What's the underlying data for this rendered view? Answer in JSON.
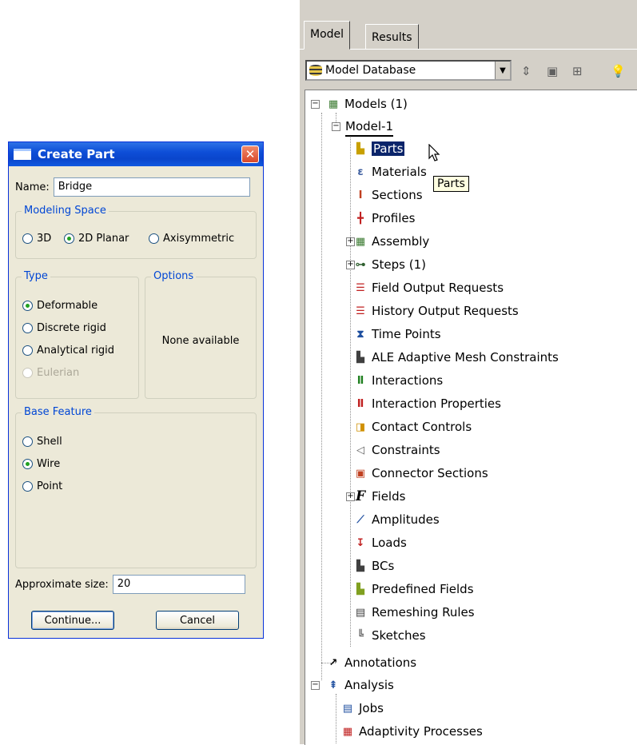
{
  "dialog": {
    "title": "Create Part",
    "name_label": "Name:",
    "name_value": "Bridge",
    "modeling_space": {
      "label": "Modeling Space",
      "options": [
        "3D",
        "2D Planar",
        "Axisymmetric"
      ],
      "selected": "2D Planar"
    },
    "type": {
      "label": "Type",
      "options": [
        "Deformable",
        "Discrete rigid",
        "Analytical rigid",
        "Eulerian"
      ],
      "selected": "Deformable",
      "disabled": [
        "Eulerian"
      ]
    },
    "options": {
      "label": "Options",
      "text": "None available"
    },
    "base_feature": {
      "label": "Base Feature",
      "options": [
        "Shell",
        "Wire",
        "Point"
      ],
      "selected": "Wire"
    },
    "approx_size_label": "Approximate size:",
    "approx_size_value": "20",
    "continue_label": "Continue...",
    "cancel_label": "Cancel"
  },
  "panel": {
    "tabs": [
      "Model",
      "Results"
    ],
    "active_tab": "Model",
    "database_label": "Model Database",
    "tooltip": "Parts",
    "tree": {
      "models": "Models (1)",
      "model1": "Model-1",
      "items": [
        "Parts",
        "Materials",
        "Sections",
        "Profiles",
        "Assembly",
        "Steps (1)",
        "Field Output Requests",
        "History Output Requests",
        "Time Points",
        "ALE Adaptive Mesh Constraints",
        "Interactions",
        "Interaction Properties",
        "Contact Controls",
        "Constraints",
        "Connector Sections",
        "Fields",
        "Amplitudes",
        "Loads",
        "BCs",
        "Predefined Fields",
        "Remeshing Rules",
        "Sketches"
      ],
      "annotations": "Annotations",
      "analysis": "Analysis",
      "analysis_items": [
        "Jobs",
        "Adaptivity Processes"
      ]
    }
  }
}
